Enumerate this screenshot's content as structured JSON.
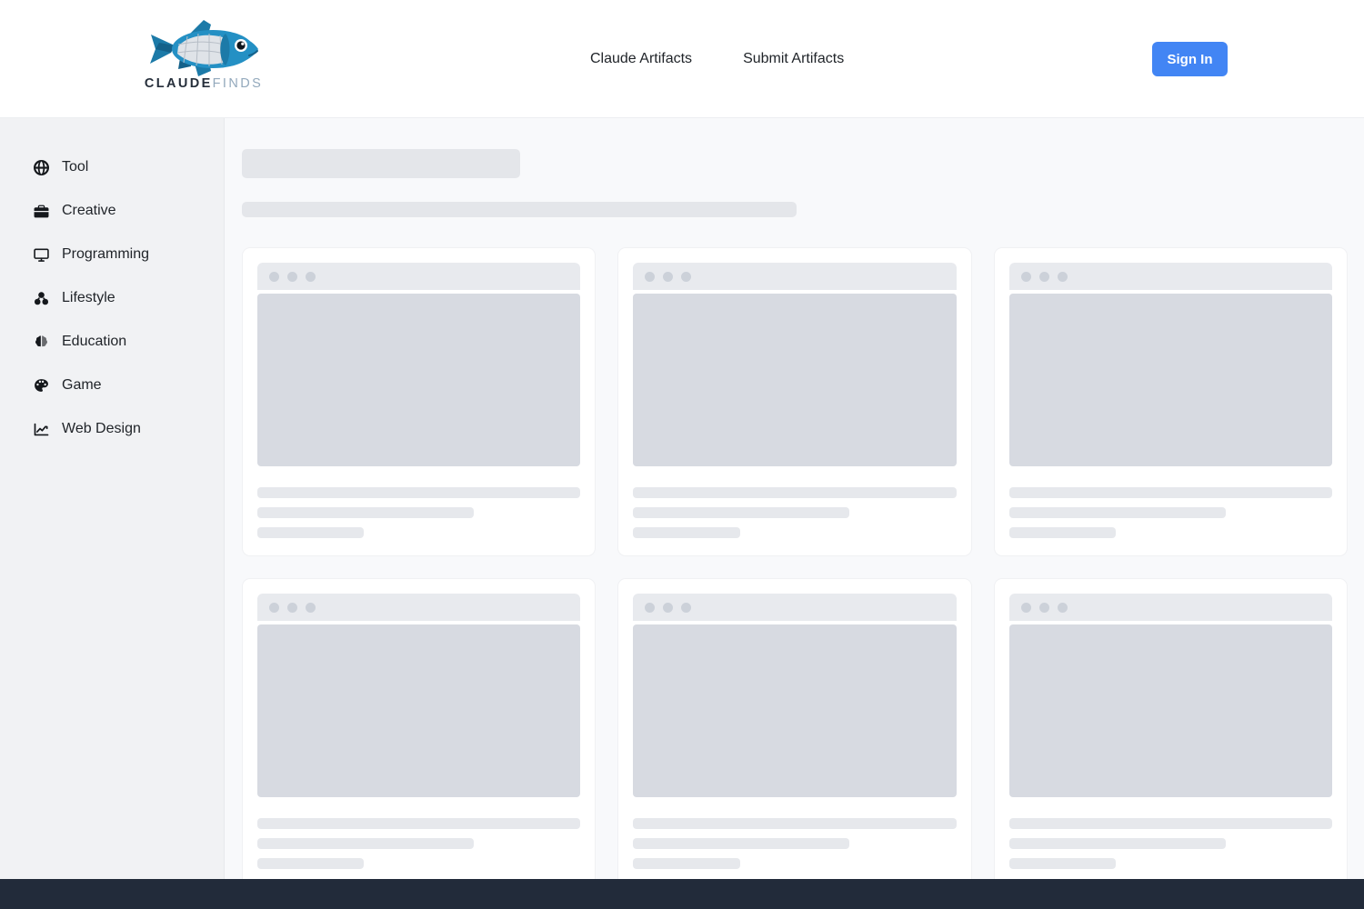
{
  "header": {
    "logo": {
      "icon": "fish-logo-icon",
      "text_primary": "CLAUDE",
      "text_secondary": "FINDS"
    },
    "nav": [
      {
        "label": "Claude Artifacts",
        "name": "nav-claude-artifacts"
      },
      {
        "label": "Submit Artifacts",
        "name": "nav-submit-artifacts"
      }
    ],
    "signin_label": "Sign In",
    "signin_color": "#4285f4"
  },
  "sidebar": {
    "items": [
      {
        "label": "Tool",
        "icon": "globe-icon"
      },
      {
        "label": "Creative",
        "icon": "briefcase-icon"
      },
      {
        "label": "Programming",
        "icon": "desktop-icon"
      },
      {
        "label": "Lifestyle",
        "icon": "cubes-icon"
      },
      {
        "label": "Education",
        "icon": "brain-icon"
      },
      {
        "label": "Game",
        "icon": "palette-icon"
      },
      {
        "label": "Web Design",
        "icon": "chart-line-icon"
      }
    ]
  },
  "main": {
    "loading": true,
    "skeleton_cards": 6,
    "colors": {
      "background": "#f8f9fb",
      "card": "#ffffff",
      "skeleton": "#e4e6ea",
      "preview": "#d7dae1",
      "browser_bar": "#e8eaee",
      "dot": "#ccd1d9"
    }
  },
  "footer": {
    "color": "#222b3a"
  }
}
